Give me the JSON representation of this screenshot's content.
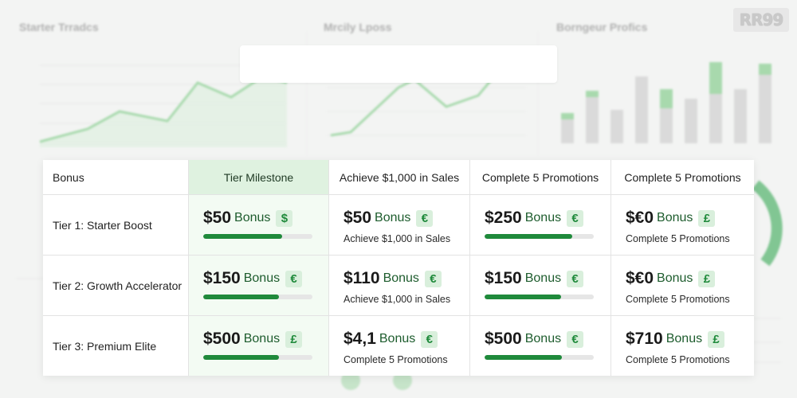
{
  "background": {
    "panels": [
      {
        "title": "Starter Trradcs"
      },
      {
        "title": "Mrcily Lposs"
      },
      {
        "title": "Borngeur Profics"
      }
    ],
    "logo": "RR99"
  },
  "table": {
    "headers": [
      "Bonus",
      "Tier Milestone",
      "Achieve $1,000 in Sales",
      "Complete 5 Promotions",
      "Complete 5 Promotions"
    ],
    "bonus_word": "Bonus",
    "rows": [
      {
        "label": "Tier 1: Starter Boost",
        "cells": [
          {
            "amount": "$50",
            "currency": "$",
            "progress": 0.72
          },
          {
            "amount": "$50",
            "currency": "€",
            "subtext": "Achieve $1,000 in Sales"
          },
          {
            "amount": "$250",
            "currency": "€",
            "progress": 0.8
          },
          {
            "amount": "$€0",
            "currency": "£",
            "subtext": "Complete 5 Promotions"
          }
        ]
      },
      {
        "label": "Tier 2: Growth Accelerator",
        "cells": [
          {
            "amount": "$150",
            "currency": "€",
            "progress": 0.69
          },
          {
            "amount": "$110",
            "currency": "€",
            "subtext": "Achieve $1,000 in Sales"
          },
          {
            "amount": "$150",
            "currency": "€",
            "progress": 0.7
          },
          {
            "amount": "$€0",
            "currency": "£",
            "subtext": "Complete 5 Promotions"
          }
        ]
      },
      {
        "label": "Tier 3: Premium Elite",
        "cells": [
          {
            "amount": "$500",
            "currency": "£",
            "progress": 0.69
          },
          {
            "amount": "$4,1",
            "currency": "€",
            "subtext": "Complete 5 Promotions"
          },
          {
            "amount": "$500",
            "currency": "€",
            "progress": 0.71
          },
          {
            "amount": "$710",
            "currency": "£",
            "subtext": "Complete 5 Promotions"
          }
        ]
      }
    ]
  }
}
